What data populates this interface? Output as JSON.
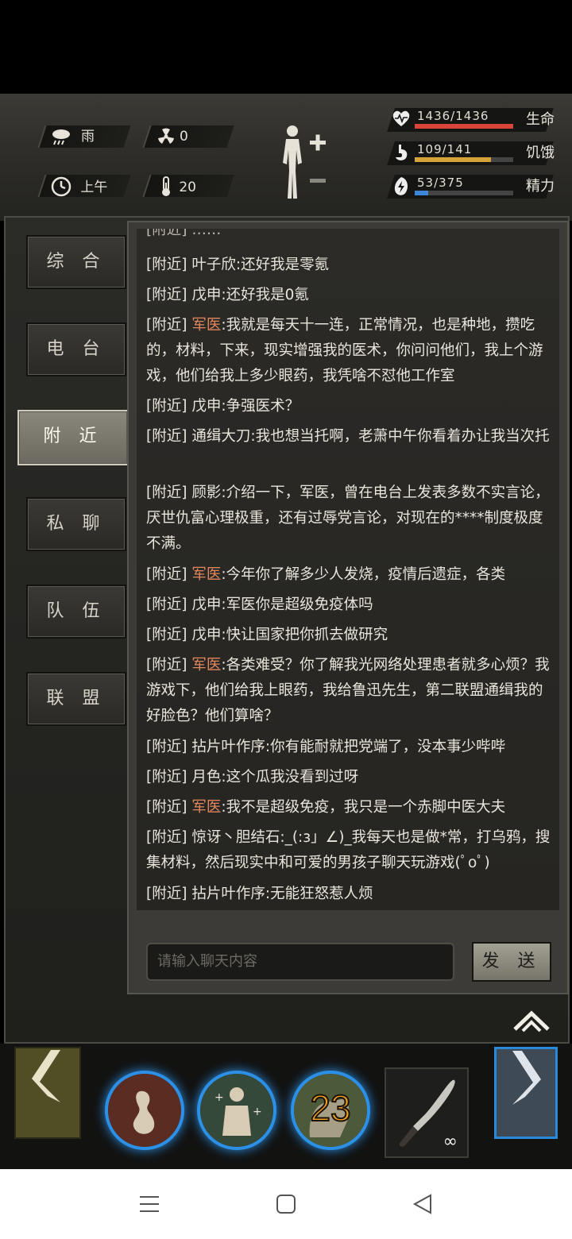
{
  "hud": {
    "weather": {
      "icon": "rain-cloud-icon",
      "label": "雨"
    },
    "radiation": {
      "icon": "radiation-icon",
      "value": "0"
    },
    "time": {
      "icon": "clock-icon",
      "label": "上午"
    },
    "temperature": {
      "icon": "thermometer-icon",
      "value": "20"
    },
    "vitals": [
      {
        "icon": "heart-icon",
        "value": "1436/1436",
        "label": "生命",
        "fill": 1.0,
        "color": "#d9453a"
      },
      {
        "icon": "stomach-icon",
        "value": "109/141",
        "label": "饥饿",
        "fill": 0.773,
        "color": "#d6a33a"
      },
      {
        "icon": "energy-icon",
        "value": "53/375",
        "label": "精力",
        "fill": 0.141,
        "color": "#3d86d8"
      }
    ]
  },
  "tabs": [
    "综 合",
    "电 台",
    "附 近",
    "私 聊",
    "队 伍",
    "联 盟"
  ],
  "active_tab": "附 近",
  "chat": {
    "messages": [
      {
        "tag": "[附近]",
        "name": "叶子欣",
        "text": ":还好我是零氪",
        "highlight": false
      },
      {
        "tag": "[附近]",
        "name": "戊申",
        "text": ":还好我是0氪",
        "highlight": false
      },
      {
        "tag": "[附近]",
        "name": "军医",
        "text": ":我就是每天十一连，正常情况，也是种地，攒吃的，材料，下来，现实增强我的医术，你问问他们，我上个游戏，他们给我上多少眼药，我凭啥不怼他工作室",
        "highlight": true
      },
      {
        "tag": "[附近]",
        "name": "戊申",
        "text": ":争强医术？",
        "highlight": false
      },
      {
        "tag": "[附近]",
        "name": "通缉大刀",
        "text": ":我也想当托啊，老萧中午你看着办让我当次托",
        "highlight": false
      },
      {
        "tag": "[附近]",
        "name": "顾影",
        "text": ":介绍一下，军医，曾在电台上发表多数不实言论，厌世仇富心理极重，还有过辱党言论，对现在的****制度极度不满。",
        "highlight": false
      },
      {
        "tag": "[附近]",
        "name": "军医",
        "text": ":今年你了解多少人发烧，疫情后遗症，各类",
        "highlight": true
      },
      {
        "tag": "[附近]",
        "name": "戊申",
        "text": ":军医你是超级免疫体吗",
        "highlight": false
      },
      {
        "tag": "[附近]",
        "name": "戊申",
        "text": ":快让国家把你抓去做研究",
        "highlight": false
      },
      {
        "tag": "[附近]",
        "name": "军医",
        "text": ":各类难受？你了解我光网络处理患者就多心烦？我游戏下，他们给我上眼药，我给鲁迅先生，第二联盟通缉我的好脸色？他们算啥？",
        "highlight": true
      },
      {
        "tag": "[附近]",
        "name": "拈片叶作序",
        "text": ":你有能耐就把党端了，没本事少哔哔",
        "highlight": false
      },
      {
        "tag": "[附近]",
        "name": "月色",
        "text": ":这个瓜我没看到过呀",
        "highlight": false
      },
      {
        "tag": "[附近]",
        "name": "军医",
        "text": ":我不是超级免疫，我只是一个赤脚中医大夫",
        "highlight": true
      },
      {
        "tag": "[附近]",
        "name": "惊讶丶胆结石",
        "text": ":_(:з」∠)_我每天也是做*常，打乌鸦，搜集材料，然后现实中和可爱的男孩子聊天玩游戏(ﾟoﾟ)",
        "highlight": false
      },
      {
        "tag": "[附近]",
        "name": "拈片叶作序",
        "text": ":无能狂怒惹人烦",
        "highlight": false
      }
    ],
    "input_placeholder": "请输入聊天内容",
    "send_label": "发 送"
  },
  "skills": [
    {
      "icon": "wound-skill-icon"
    },
    {
      "icon": "heal-figure-skill-icon"
    },
    {
      "icon": "hand-skill-icon",
      "count": "23"
    }
  ],
  "weapon": {
    "icon": "machete-icon",
    "count": "∞"
  },
  "navbar": [
    "menu-icon",
    "home-square-icon",
    "back-triangle-icon"
  ]
}
